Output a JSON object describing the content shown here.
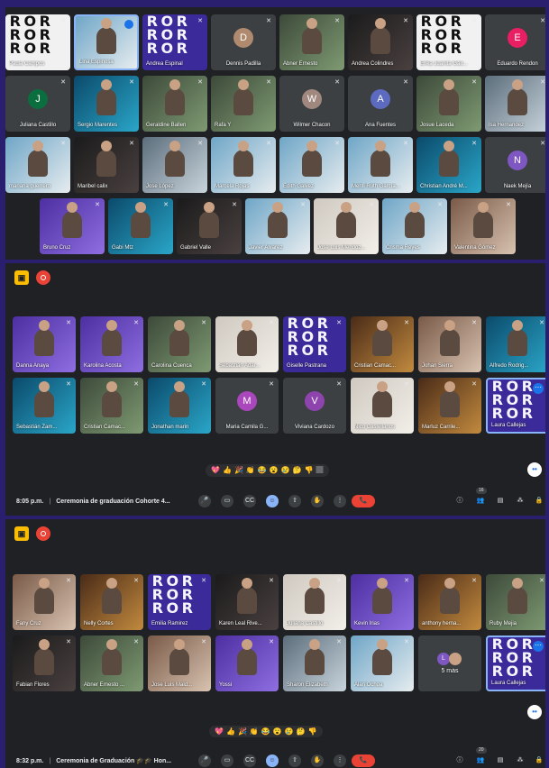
{
  "colors": {
    "accent": "#8ab4f8",
    "end_call": "#ea4335",
    "record": "#ea4335",
    "present": "#fbbc04",
    "tile": "#3c4043",
    "background": "#202124"
  },
  "screen1": {
    "rows": [
      [
        "Paula Campos",
        "Lina Espinosa",
        "Andrea Espinal",
        "Dennis Padilla",
        "Abner Ernesto",
        "Andrea Colindres",
        "Erika Juanita Gait...",
        "Eduardo Rendon"
      ],
      [
        "Juliana Castillo",
        "Sergio Marentes",
        "Geraldine Ballen",
        "Rafa Y",
        "Wilmer Chacon",
        "Ana Fuentes",
        "Josue Laceda",
        "Isa Hernandez"
      ],
      [
        "mariana guerrero",
        "Maribel calix",
        "Jose López",
        "Marcela Rojas",
        "Edith Galvez",
        "Menfi Ruth García...",
        "Christian André M...",
        "Naek Mejía"
      ],
      [
        "Bruno Cruz",
        "Gabi Mtz",
        "Gabriel Valle",
        "Javier Alvarez",
        "Jose Luis Mendoz...",
        "Crisma Reyes",
        "Valentina Gómez"
      ]
    ],
    "initials": {
      "Dennis Padilla": "D",
      "Eduardo Rendon": "E",
      "Juliana Castillo": "J",
      "Wilmer Chacon": "W",
      "Ana Fuentes": "A",
      "Naek Mejía": "N"
    }
  },
  "screen2": {
    "rows": [
      [
        "Danna Anaya",
        "Karolina Acosta",
        "Carolina Cuenca",
        "Sebastián Adar...",
        "Giselle Pastrana",
        "Cristian Camac...",
        "Johan Sierra",
        "Alfredo Rodrig..."
      ],
      [
        "Sebastián Zam...",
        "Cristian Camac...",
        "Jonathan marin",
        "Maria Camila G...",
        "Viviana Cardozo",
        "Nico Castellanos",
        "Marluz Carrile...",
        "Laura Callejas"
      ]
    ],
    "initials": {
      "Maria Camila G...": "M",
      "Viviana Cardozo": "V"
    },
    "time": "8:05 p.m.",
    "meeting_title": "Ceremonia de graduación Cohorte 4...",
    "people_count": "16",
    "reactions": [
      "💖",
      "👍",
      "🎉",
      "👏",
      "😂",
      "😮",
      "😢",
      "🤔",
      "👎",
      "🏽"
    ]
  },
  "screen3": {
    "rows": [
      [
        "Fany Cruz",
        "Nelly Cortes",
        "Emilia Ramirez",
        "Karen Leal Rive...",
        "Juliana Castillo",
        "Kevin Irias",
        "anthony herna...",
        "Ruby Mejia"
      ],
      [
        "Fabian Flores",
        "Abner Ernesto ...",
        "Jose Luis Mald...",
        "Yossi",
        "Sharon Elizabeth",
        "Alan Ochoa",
        "5 más",
        "Laura Callejas"
      ]
    ],
    "more_initial": "L",
    "time": "8:32 p.m.",
    "meeting_title": "Ceremonia de Graduación 🎓🎓 Hon...",
    "people_count": "20",
    "reactions": [
      "💖",
      "👍",
      "🎉",
      "👏",
      "😂",
      "😮",
      "😢",
      "🤔",
      "👎"
    ]
  },
  "controls": {
    "mic": "🎤",
    "cam": "▭",
    "cc": "CC",
    "emoji": "☺",
    "present": "⇧",
    "hand": "✋",
    "more": "⋮",
    "end": "📞",
    "info": "ⓘ",
    "people": "👥",
    "chat": "▤",
    "activities": "⁂",
    "lock": "🔒"
  },
  "icons": {
    "mic_off": "✕",
    "present_icon": "▣",
    "fab": "••"
  }
}
